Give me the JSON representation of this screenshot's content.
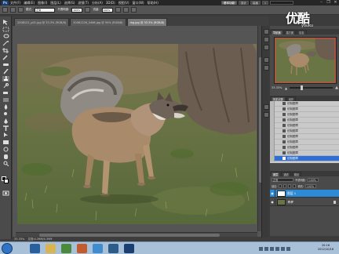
{
  "app": {
    "logo": "Ps",
    "menu": [
      "文件(F)",
      "编辑(E)",
      "图像(I)",
      "图层(L)",
      "选择(S)",
      "滤镜(T)",
      "分析(A)",
      "3D(D)",
      "视图(V)",
      "窗口(W)",
      "帮助(H)"
    ],
    "zoom_display": "33.3",
    "workspace_buttons": [
      "基本功能",
      "设计",
      "绘画"
    ],
    "more_label": "»"
  },
  "options_bar": {
    "mode_label": "模式:",
    "mode_value": "正常",
    "opacity_label": "不透明度:",
    "opacity_value": "100%",
    "flow_label": "流量:",
    "flow_value": "100%"
  },
  "tabs": [
    {
      "label": "2008121_p01.jpg @ 33.3% (RGB/8)",
      "active": false
    },
    {
      "label": "20081228_0466.jpg @ 50% (RGB/8)",
      "active": false
    },
    {
      "label": "rkg.jpg @ 33.3% (RGB/8)",
      "active": true
    }
  ],
  "status": {
    "zoom": "33.33%",
    "doc": "文档:4.39M/4.39M"
  },
  "panels": {
    "navigator_tabs": [
      "导航器",
      "直方图",
      "信息"
    ],
    "navigator_zoom": "33.33%",
    "history_tabs": [
      "历史记录",
      "动作"
    ],
    "history_items": [
      "仿制图章",
      "仿制图章",
      "仿制图章",
      "仿制图章",
      "仿制图章",
      "仿制图章",
      "仿制图章",
      "仿制图章",
      "仿制图章",
      "仿制图章",
      "仿制图章",
      "仿制图章"
    ],
    "history_selected": 11,
    "layers_tabs": [
      "图层",
      "通道",
      "路径"
    ],
    "blend_mode": "正常",
    "opacity_label": "不透明度:",
    "opacity": "100%",
    "lock_label": "锁定:",
    "fill_label": "填充:",
    "fill": "100%",
    "layers": [
      {
        "name": "图层 1",
        "selected": true
      },
      {
        "name": "背景",
        "selected": false
      }
    ]
  },
  "taskbar": {
    "time": "20:16",
    "date": "2012/10/16"
  },
  "watermark": {
    "main": "优酷",
    "sub": "youku"
  },
  "colors": {
    "selection": "#2d6fd6",
    "layer_selection": "#2d8bd6",
    "ui_dark": "#3c3c3c"
  }
}
